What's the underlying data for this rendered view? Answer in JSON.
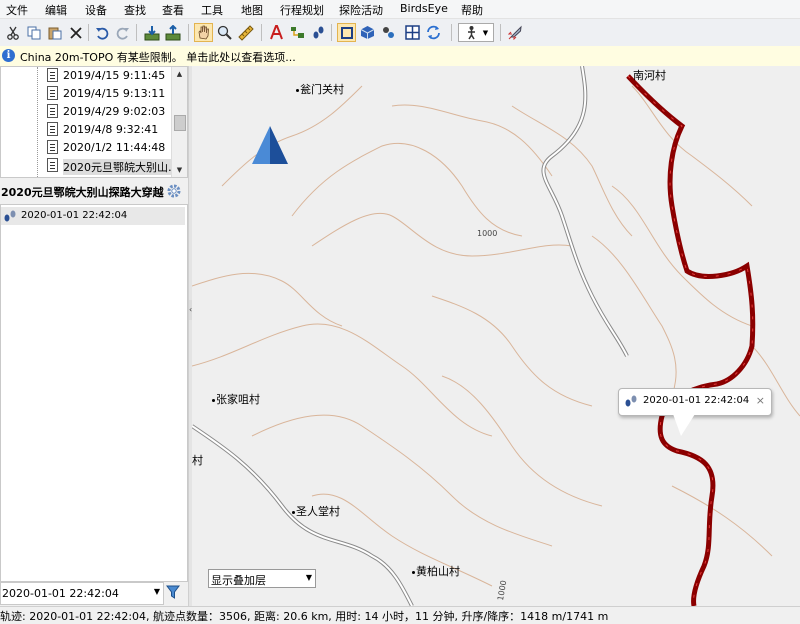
{
  "menu": [
    "文件",
    "编辑",
    "设备",
    "查找",
    "查看",
    "工具",
    "地图",
    "行程规划",
    "探险活动",
    "BirdsEye",
    "帮助"
  ],
  "infobar": {
    "text": "China 20m-TOPO 有某些限制。 单击此处以查看选项..."
  },
  "tree": {
    "items": [
      "2019/4/15 9:11:45",
      "2019/4/15 9:13:11",
      "2019/4/29 9:02:03",
      "2019/4/8 9:32:41",
      "2020/1/2 11:44:48",
      "2020元旦鄂皖大别山…"
    ]
  },
  "panel": {
    "title": "2020元旦鄂皖大别山探路大穿越"
  },
  "list": {
    "items": [
      "2020-01-01 22:42:04"
    ]
  },
  "bottom_combo": {
    "value": "2020-01-01 22:42:04"
  },
  "map": {
    "places": [
      "瓮门关村",
      "南河村",
      "张家咀村",
      "村",
      "圣人堂村",
      "黄柏山村"
    ],
    "contours": [
      "1000",
      "1000"
    ],
    "callout": "2020-01-01 22:42:04",
    "overlay_select": "显示叠加层",
    "track_color": "#8b0000"
  },
  "status": {
    "text": "轨迹: 2020-01-01 22:42:04, 航迹点数量：3506, 距离: 20.6 km, 用时: 14 小时，11 分钟, 升序/降序：1418 m/1741 m"
  }
}
